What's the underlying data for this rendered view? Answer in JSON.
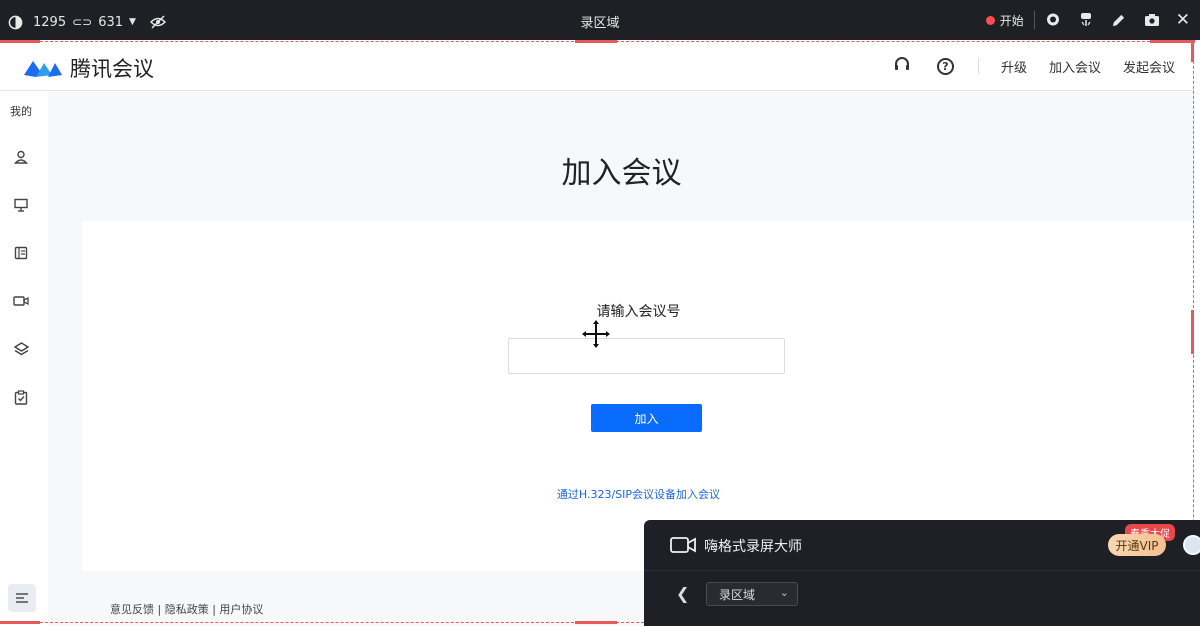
{
  "recorder_bar": {
    "dimensions": "1295",
    "dimensions2": "631",
    "title": "录区域",
    "start_label": "开始"
  },
  "header": {
    "logo_text": "腾讯会议",
    "nav": [
      "升级",
      "加入会议",
      "发起会议"
    ]
  },
  "sidebar": {
    "mine_label": "我的"
  },
  "main": {
    "title": "加入会议",
    "prompt": "请输入会议号",
    "input_value": "",
    "join_button": "加入",
    "sip_link": "通过H.323/SIP会议设备加入会议",
    "footer": [
      "意见反馈",
      "隐私政策",
      "用户协议"
    ]
  },
  "recorder_panel": {
    "app_name": "嗨格式录屏大师",
    "vip_button": "开通VIP",
    "promo_badge": "春季大促",
    "region_select": "录区域"
  }
}
